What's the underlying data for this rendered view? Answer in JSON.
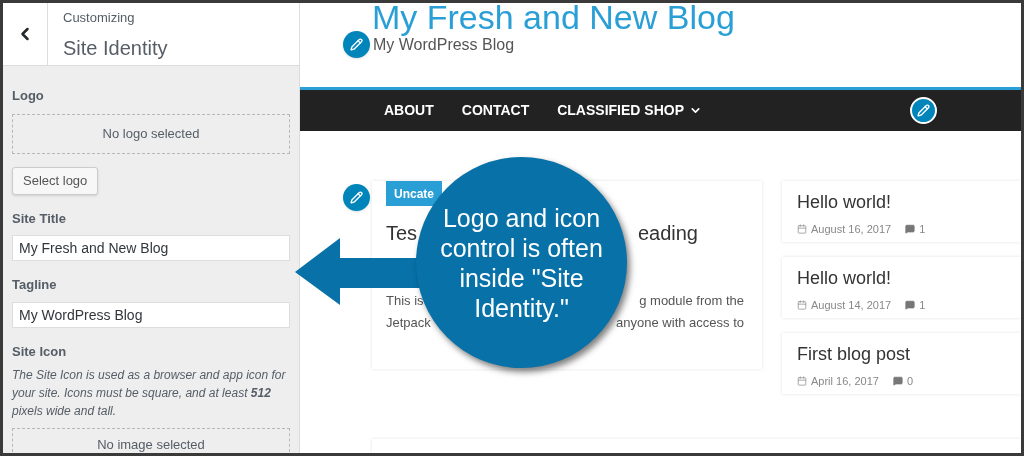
{
  "panel": {
    "context": "Customizing",
    "title": "Site Identity"
  },
  "logo": {
    "label": "Logo",
    "empty": "No logo selected",
    "button": "Select logo"
  },
  "fields": [
    {
      "label": "Site Title",
      "value": "My Fresh and New Blog"
    },
    {
      "label": "Tagline",
      "value": "My WordPress Blog"
    }
  ],
  "site_icon": {
    "label": "Site Icon",
    "description": "The Site Icon is used as a browser and app icon for your site. Icons must be square, and at least **512** pixels wide and tall.",
    "empty": "No image selected"
  },
  "preview": {
    "site_title": "My Fresh and New Blog",
    "tagline": "My WordPress Blog",
    "nav": [
      {
        "label": "ABOUT",
        "has_submenu": false
      },
      {
        "label": "CONTACT",
        "has_submenu": false
      },
      {
        "label": "CLASSIFIED SHOP",
        "has_submenu": true
      }
    ],
    "featured": {
      "category": "Uncate",
      "title_parts": [
        "Tes",
        "eading"
      ],
      "excerpt_lines": [
        [
          "This is",
          "g module from the"
        ],
        [
          "Jetpack",
          "anyone with access to"
        ]
      ]
    },
    "recent_posts": [
      {
        "title": "Hello world!",
        "date": "August 16, 2017",
        "comments": "1"
      },
      {
        "title": "Hello world!",
        "date": "August 14, 2017",
        "comments": "1"
      },
      {
        "title": "First blog post",
        "date": "April 16, 2017",
        "comments": "0"
      }
    ]
  },
  "callout": {
    "text": "Logo and icon control is often inside \"Site Identity.\""
  }
}
